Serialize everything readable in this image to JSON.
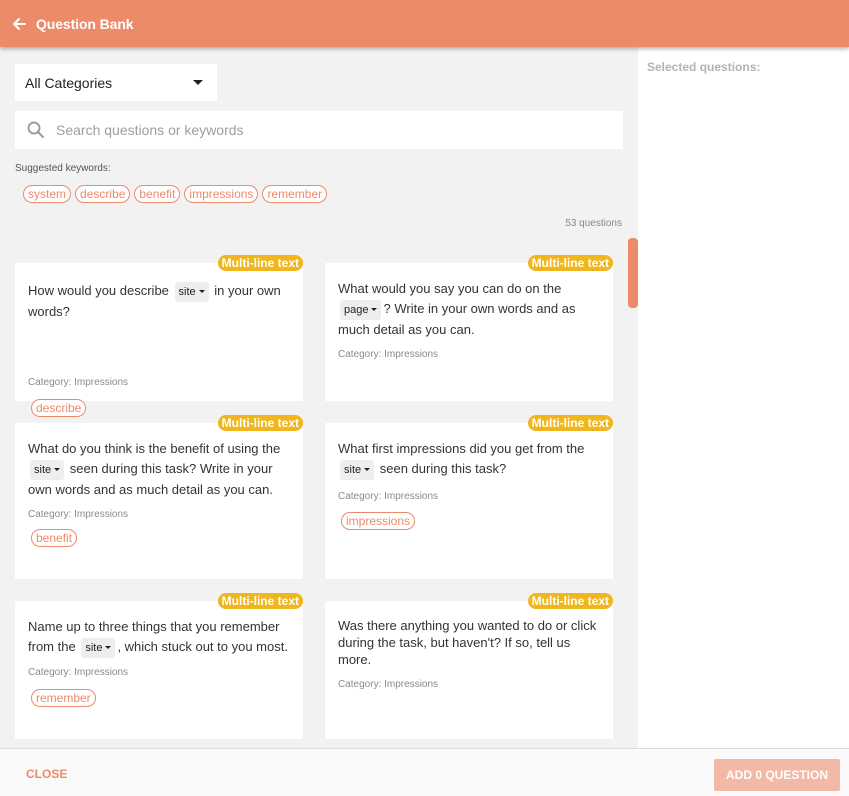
{
  "header": {
    "title": "Question Bank",
    "back_icon": "arrow-left-icon"
  },
  "colors": {
    "accent": "#ec8b6a",
    "badge": "#f1b61e",
    "add_disabled": "#f3b9a6"
  },
  "filters": {
    "category_selected": "All Categories",
    "search_placeholder": "Search questions or keywords",
    "suggested_label": "Suggested keywords:",
    "keywords": [
      "system",
      "describe",
      "benefit",
      "impressions",
      "remember"
    ]
  },
  "question_count": "53 questions",
  "cards": [
    {
      "badge": "Multi-line text",
      "parts": [
        "How would you describe",
        "site",
        "in your own words?"
      ],
      "category": "Category: Impressions",
      "tag": "describe"
    },
    {
      "badge": "Multi-line text",
      "parts": [
        "What would you say you can do on the",
        "page",
        "? Write in your own words and as much detail as you can."
      ],
      "category": "Category: Impressions",
      "tag": ""
    },
    {
      "badge": "Multi-line text",
      "parts": [
        "What do you think is the benefit of using the",
        "site",
        "seen during this task? Write in your own words and as much detail as you can."
      ],
      "category": "Category: Impressions",
      "tag": "benefit"
    },
    {
      "badge": "Multi-line text",
      "parts": [
        "What first impressions did you get from the",
        "site",
        "seen during this task?"
      ],
      "category": "Category: Impressions",
      "tag": "impressions"
    },
    {
      "badge": "Multi-line text",
      "parts": [
        "Name up to three things that you remember from the",
        "site",
        ", which stuck out to you most."
      ],
      "category": "Category: Impressions",
      "tag": "remember"
    },
    {
      "badge": "Multi-line text",
      "parts": [
        "Was there anything you wanted to do or click during the task, but haven't? If so, tell us more."
      ],
      "category": "Category: Impressions",
      "tag": ""
    }
  ],
  "right_panel": {
    "title": "Selected questions:"
  },
  "footer": {
    "close_label": "CLOSE",
    "add_label": "ADD 0 QUESTION"
  }
}
